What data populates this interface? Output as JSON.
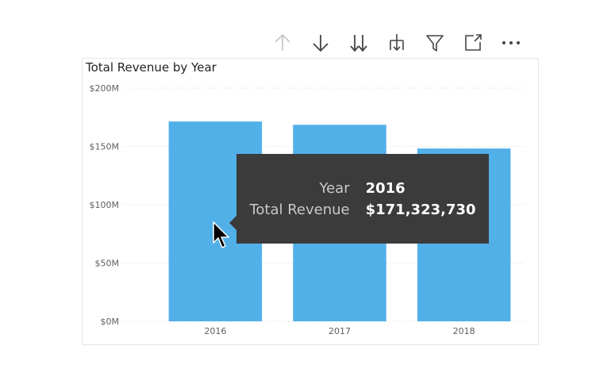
{
  "toolbar": {
    "buttons": [
      {
        "icon": "arrow-up-icon"
      },
      {
        "icon": "arrow-down-icon"
      },
      {
        "icon": "double-arrow-down-icon"
      },
      {
        "icon": "expand-hierarchy-icon"
      },
      {
        "icon": "filter-icon"
      },
      {
        "icon": "focus-mode-icon"
      },
      {
        "icon": "more-options-icon"
      }
    ]
  },
  "visual": {
    "title": "Total Revenue by Year"
  },
  "colors": {
    "bar": "#52b0e9",
    "grid": "#d9d9d9",
    "tooltip_bg": "#3b3b3b"
  },
  "chart_data": {
    "type": "bar",
    "title": "Total Revenue by Year",
    "xlabel": "",
    "ylabel": "",
    "categories": [
      "2016",
      "2017",
      "2018"
    ],
    "values": [
      171323730,
      168500000,
      148200000
    ],
    "ylim": [
      0,
      200000000
    ],
    "yticks": [
      {
        "value": 0,
        "label": "$0M"
      },
      {
        "value": 50000000,
        "label": "$50M"
      },
      {
        "value": 100000000,
        "label": "$100M"
      },
      {
        "value": 150000000,
        "label": "$150M"
      },
      {
        "value": 200000000,
        "label": "$200M"
      }
    ],
    "grid": true
  },
  "tooltip": {
    "rows": [
      {
        "key": "Year",
        "value": "2016"
      },
      {
        "key": "Total Revenue",
        "value": "$171,323,730"
      }
    ]
  }
}
